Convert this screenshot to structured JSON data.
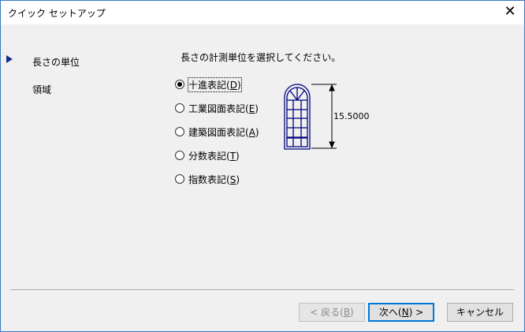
{
  "window": {
    "title": "クイック セットアップ"
  },
  "nav": {
    "items": [
      {
        "label": "長さの単位",
        "active": true
      },
      {
        "label": "領域",
        "active": false
      }
    ]
  },
  "main": {
    "instruction": "長さの計測単位を選択してください。",
    "options": [
      {
        "label": "十進表記",
        "key": "D",
        "selected": true
      },
      {
        "label": "工業図面表記",
        "key": "E",
        "selected": false
      },
      {
        "label": "建築図面表記",
        "key": "A",
        "selected": false
      },
      {
        "label": "分数表記",
        "key": "T",
        "selected": false
      },
      {
        "label": "指数表記",
        "key": "S",
        "selected": false
      }
    ],
    "preview_value": "15.5000"
  },
  "buttons": {
    "back": {
      "label": "< 戻る",
      "key": "B"
    },
    "next": {
      "label": "次へ",
      "key": "N",
      "suffix": " >"
    },
    "cancel": {
      "label": "キャンセル"
    }
  }
}
